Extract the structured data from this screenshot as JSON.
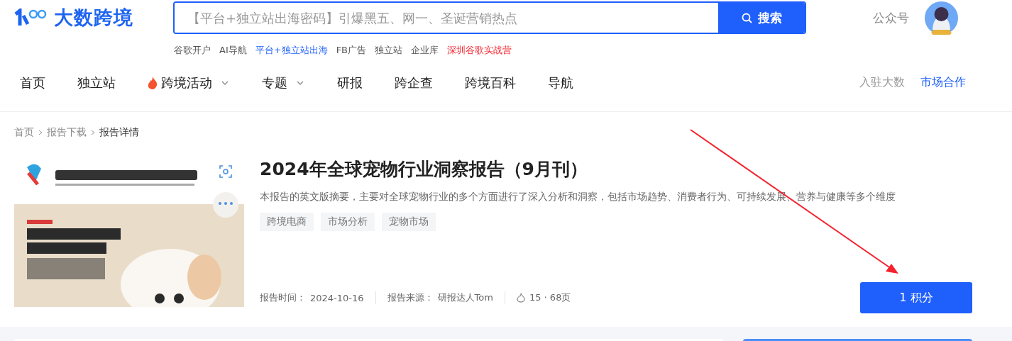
{
  "header": {
    "logo_text": "大数跨境",
    "search": {
      "placeholder": "【平台+独立站出海密码】引爆黑五、网一、圣诞营销热点",
      "button": "搜索"
    },
    "account_link": "公众号"
  },
  "hot_links": [
    {
      "label": "谷歌开户",
      "kind": "normal"
    },
    {
      "label": "AI导航",
      "kind": "normal"
    },
    {
      "label": "平台+独立站出海",
      "kind": "highlight"
    },
    {
      "label": "FB广告",
      "kind": "normal"
    },
    {
      "label": "独立站",
      "kind": "normal"
    },
    {
      "label": "企业库",
      "kind": "normal"
    },
    {
      "label": "深圳谷歌实战营",
      "kind": "hot"
    }
  ],
  "nav": {
    "items": [
      {
        "label": "首页",
        "hot": false,
        "dropdown": false
      },
      {
        "label": "独立站",
        "hot": false,
        "dropdown": false
      },
      {
        "label": "跨境活动",
        "hot": true,
        "dropdown": true
      },
      {
        "label": "专题",
        "hot": false,
        "dropdown": true
      },
      {
        "label": "研报",
        "hot": false,
        "dropdown": false
      },
      {
        "label": "跨企查",
        "hot": false,
        "dropdown": false
      },
      {
        "label": "跨境百科",
        "hot": false,
        "dropdown": false
      },
      {
        "label": "导航",
        "hot": false,
        "dropdown": false
      }
    ],
    "right_links": [
      {
        "label": "入驻大数",
        "kind": "muted"
      },
      {
        "label": "市场合作",
        "kind": "accent"
      }
    ]
  },
  "breadcrumb": [
    "首页",
    "报告下载",
    "报告详情"
  ],
  "report": {
    "title": "2024年全球宠物行业洞察报告（9月刊）",
    "description": "本报告的英文版摘要，主要对全球宠物行业的多个方面进行了深入分析和洞察，包括市场趋势、消费者行为、可持续发展、营养与健康等多个维度",
    "tags": [
      "跨境电商",
      "市场分析",
      "宠物市场"
    ],
    "meta": [
      {
        "kind": "date",
        "label": "报告时间：",
        "value": "2024-10-16"
      },
      {
        "kind": "source",
        "label": "报告来源：",
        "value": "研报达人Tom"
      },
      {
        "kind": "stats",
        "value": "15 · 68页"
      }
    ],
    "button": "1 积分"
  }
}
